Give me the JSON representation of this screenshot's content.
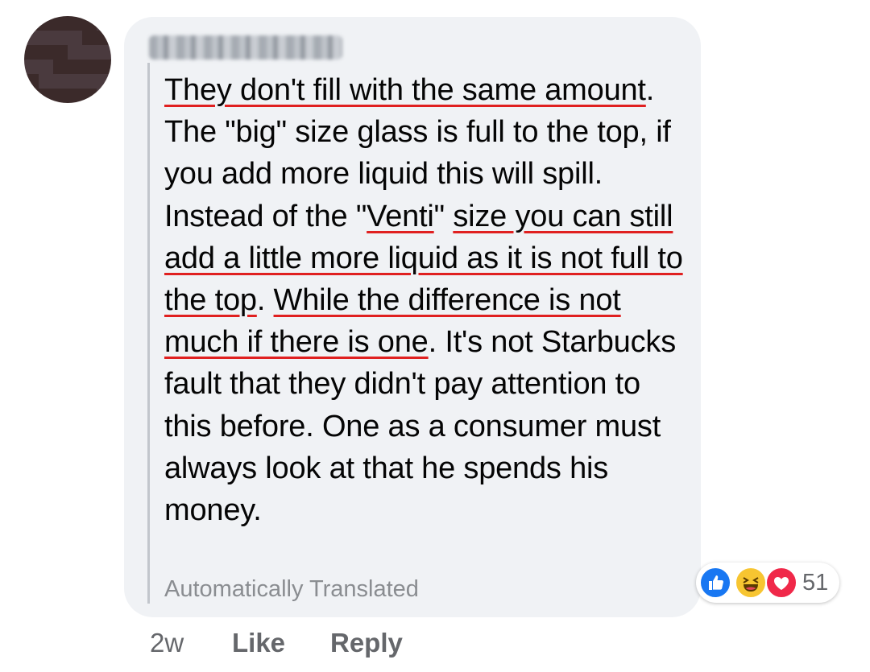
{
  "comment": {
    "segments": [
      {
        "text": "They don't fill with the same amount",
        "underline": true
      },
      {
        "text": ". The \"big\" size glass is full to the top, if you add more liquid this will spill. Instead of the \"",
        "underline": false
      },
      {
        "text": "Venti",
        "underline": true
      },
      {
        "text": "\" ",
        "underline": false
      },
      {
        "text": "size you can still add a little more liquid as it is not full to the top",
        "underline": true
      },
      {
        "text": ". ",
        "underline": false
      },
      {
        "text": "While the difference is not much if there is one",
        "underline": true
      },
      {
        "text": ". It's not Starbucks fault that they didn't pay attention to this before. One as a consumer must always look at that he spends his money.",
        "underline": false
      }
    ],
    "translation_note": "Automatically Translated"
  },
  "reactions": {
    "icons": [
      "like-icon",
      "haha-icon",
      "love-icon"
    ],
    "count": "51",
    "colors": {
      "like": "#1877f2",
      "haha": "#f7c531",
      "love": "#f02849"
    }
  },
  "actions": {
    "time": "2w",
    "like": "Like",
    "reply": "Reply"
  },
  "colors": {
    "bubble": "#f0f2f5",
    "underline": "#e02020",
    "meta_text": "#65676b"
  }
}
